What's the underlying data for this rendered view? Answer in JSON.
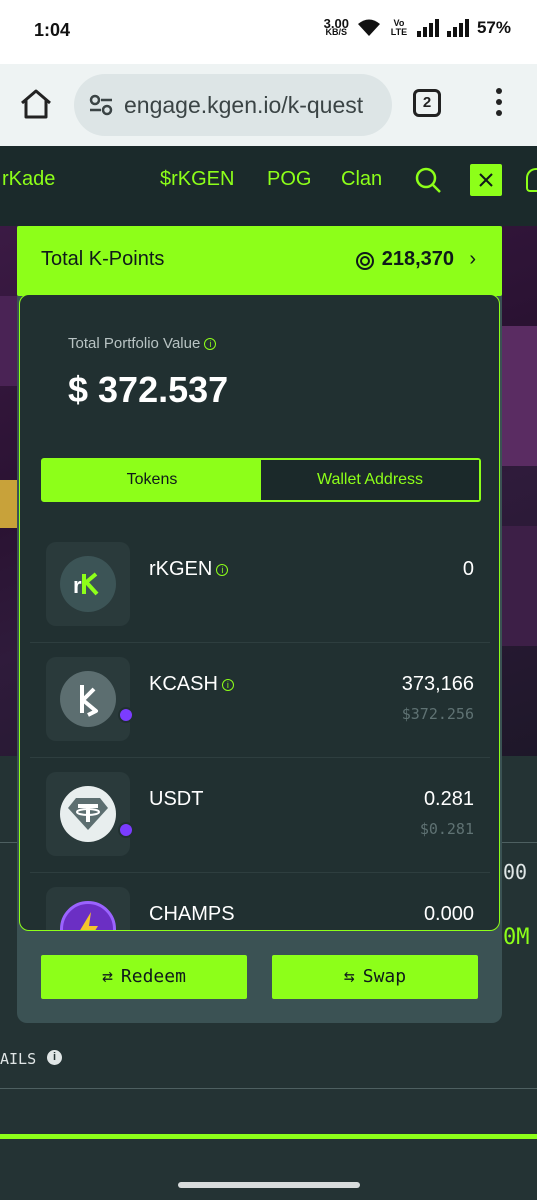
{
  "status_bar": {
    "time": "1:04",
    "net_speed_value": "3.00",
    "net_speed_unit": "KB/S",
    "volte": "Vo LTE",
    "battery": "57%"
  },
  "browser": {
    "url": "engage.kgen.io/k-quest",
    "tab_count": "2"
  },
  "nav": {
    "items": [
      "rKade",
      "$rKGEN",
      "POG",
      "Clan"
    ]
  },
  "kpoints": {
    "label": "Total K-Points",
    "value": "218,370"
  },
  "portfolio": {
    "label": "Total Portfolio Value",
    "value": "$ 372.537"
  },
  "tabs": {
    "tokens": "Tokens",
    "wallet": "Wallet Address"
  },
  "tokens": [
    {
      "name": "rKGEN",
      "balance": "0",
      "usd": ""
    },
    {
      "name": "KCASH",
      "balance": "373,166",
      "usd": "$372.256"
    },
    {
      "name": "USDT",
      "balance": "0.281",
      "usd": "$0.281"
    },
    {
      "name": "CHAMPS",
      "balance": "0.000",
      "usd": ""
    }
  ],
  "actions": {
    "redeem": "Redeem",
    "swap": "Swap"
  },
  "background": {
    "value_right_1": "00",
    "value_right_2": "0M",
    "details_label": "AILS"
  },
  "colors": {
    "accent": "#8dff19",
    "panel_bg": "#213031",
    "page_bg": "#1d2a2b"
  }
}
